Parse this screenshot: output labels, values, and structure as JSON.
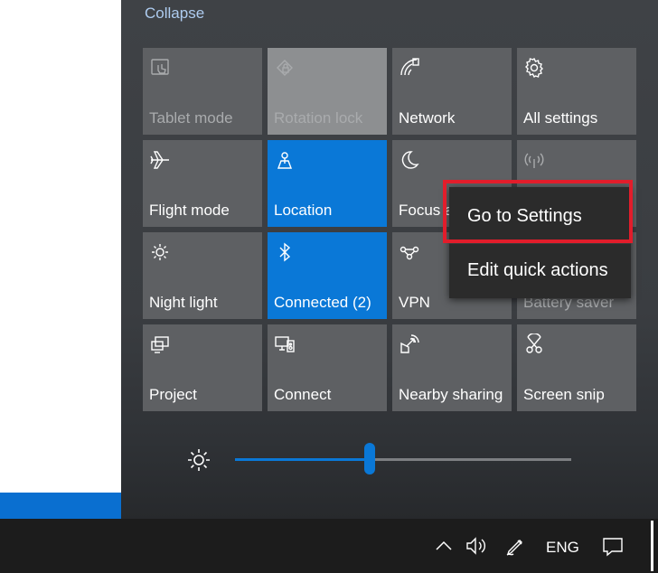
{
  "panel": {
    "collapse_label": "Collapse"
  },
  "tiles": [
    {
      "label": "Tablet mode",
      "icon": "tablet-mode-icon",
      "state": "disabled"
    },
    {
      "label": "Rotation lock",
      "icon": "rotation-lock-icon",
      "state": "disabled"
    },
    {
      "label": "Network",
      "icon": "network-icon",
      "state": "off"
    },
    {
      "label": "All settings",
      "icon": "gear-icon",
      "state": "off"
    },
    {
      "label": "Flight mode",
      "icon": "airplane-icon",
      "state": "off"
    },
    {
      "label": "Location",
      "icon": "location-icon",
      "state": "on"
    },
    {
      "label": "Focus a",
      "icon": "moon-icon",
      "state": "off"
    },
    {
      "label": "",
      "icon": "mobile-hotspot-icon",
      "state": "disabled"
    },
    {
      "label": "Night light",
      "icon": "night-light-icon",
      "state": "off"
    },
    {
      "label": "Connected (2)",
      "icon": "bluetooth-icon",
      "state": "on"
    },
    {
      "label": "VPN",
      "icon": "vpn-icon",
      "state": "off"
    },
    {
      "label": "Battery saver",
      "icon": "battery-saver-icon",
      "state": "disabled"
    },
    {
      "label": "Project",
      "icon": "project-icon",
      "state": "off"
    },
    {
      "label": "Connect",
      "icon": "connect-icon",
      "state": "off"
    },
    {
      "label": "Nearby sharing",
      "icon": "nearby-sharing-icon",
      "state": "off"
    },
    {
      "label": "Screen snip",
      "icon": "screen-snip-icon",
      "state": "off"
    }
  ],
  "brightness": {
    "icon": "brightness-icon",
    "level_fraction": 0.4
  },
  "context_menu": {
    "items": [
      {
        "label": "Go to Settings",
        "highlighted": true
      },
      {
        "label": "Edit quick actions",
        "highlighted": false
      }
    ]
  },
  "taskbar": {
    "language": "ENG",
    "icons": [
      "chevron-up-icon",
      "volume-icon",
      "pen-icon",
      "notification-icon"
    ]
  },
  "colors": {
    "accent": "#0a78d7",
    "tile": "#5e6063",
    "highlight_border": "#e21d2b",
    "taskbar": "#1c1c1c"
  }
}
